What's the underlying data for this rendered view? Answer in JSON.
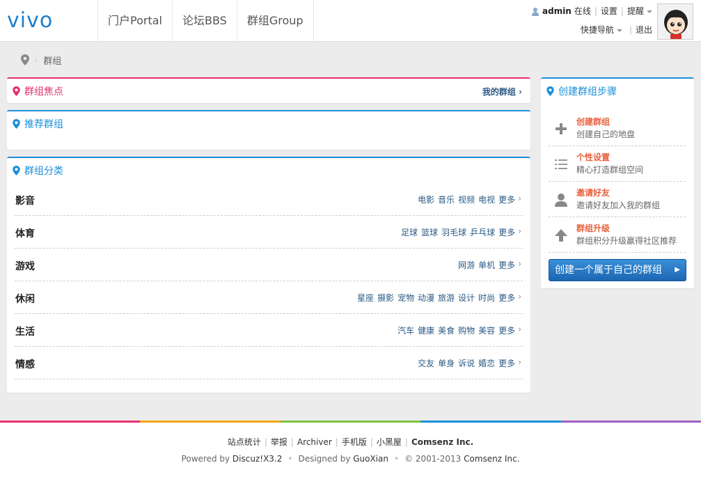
{
  "header": {
    "logo": "vivo",
    "nav": [
      "门户Portal",
      "论坛BBS",
      "群组Group"
    ],
    "user": {
      "name": "admin",
      "status": "在线",
      "settings": "设置",
      "remind": "提醒",
      "quicknav": "快捷导航",
      "logout": "退出"
    }
  },
  "breadcrumb": {
    "current": "群组"
  },
  "focus": {
    "title": "群组焦点",
    "my_groups": "我的群组"
  },
  "recommend": {
    "title": "推荐群组"
  },
  "category": {
    "title": "群组分类",
    "more": "更多",
    "rows": [
      {
        "name": "影音",
        "links": [
          "电影",
          "音乐",
          "视频",
          "电视"
        ]
      },
      {
        "name": "体育",
        "links": [
          "足球",
          "篮球",
          "羽毛球",
          "乒乓球"
        ]
      },
      {
        "name": "游戏",
        "links": [
          "网游",
          "单机"
        ]
      },
      {
        "name": "休闲",
        "links": [
          "星座",
          "摄影",
          "宠物",
          "动漫",
          "旅游",
          "设计",
          "时尚"
        ]
      },
      {
        "name": "生活",
        "links": [
          "汽车",
          "健康",
          "美食",
          "购物",
          "美容"
        ]
      },
      {
        "name": "情感",
        "links": [
          "交友",
          "单身",
          "诉说",
          "婚恋"
        ]
      }
    ]
  },
  "steps": {
    "title": "创建群组步骤",
    "items": [
      {
        "title": "创建群组",
        "desc": "创建自己的地盘",
        "icon": "plus-icon"
      },
      {
        "title": "个性设置",
        "desc": "精心打造群组空间",
        "icon": "list-icon"
      },
      {
        "title": "邀请好友",
        "desc": "邀请好友加入我的群组",
        "icon": "person-icon"
      },
      {
        "title": "群组升级",
        "desc": "群组积分升级赢得社区推荐",
        "icon": "up-arrow-icon"
      }
    ],
    "button": "创建一个属于自己的群组"
  },
  "footer": {
    "links": [
      "站点统计",
      "举报",
      "Archiver",
      "手机版",
      "小黑屋"
    ],
    "company": "Comsenz Inc.",
    "powered_prefix": "Powered by ",
    "powered_name": "Discuz!",
    "powered_ver": "X3.2",
    "designed_prefix": "Designed by ",
    "designer": "GuoXian",
    "copyright": "© 2001-2013 ",
    "copyright_company": "Comsenz Inc.",
    "colors": [
      "#e5306e",
      "#f5a31a",
      "#7cc242",
      "#1c8fd8",
      "#a061c0"
    ]
  },
  "colors": {
    "pink": "#e5306e",
    "blue": "#1c8fd8",
    "orange": "#e8603c",
    "link": "#2a5a85"
  }
}
